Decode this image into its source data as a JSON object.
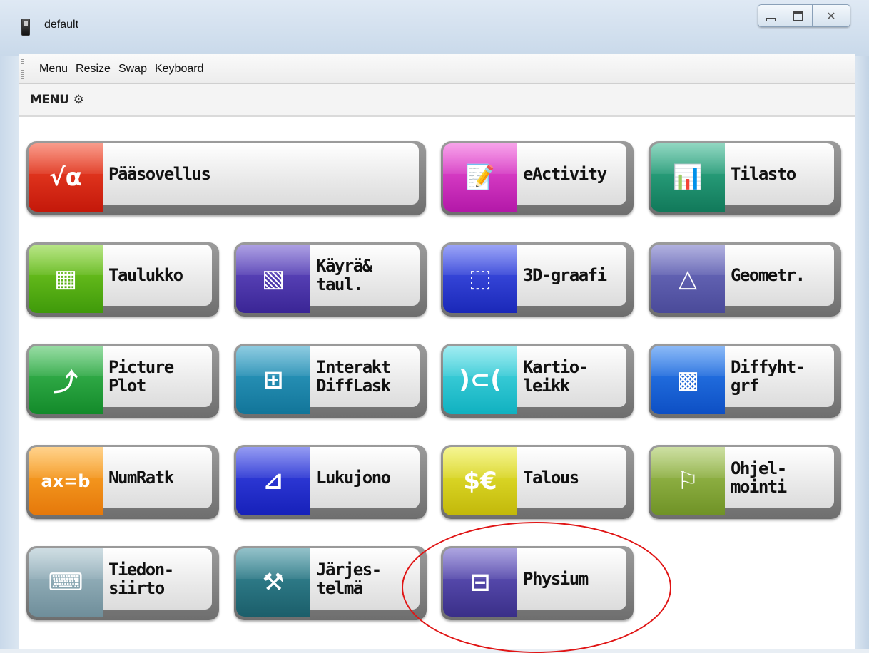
{
  "window": {
    "title": "default",
    "controls": {
      "minimize": "minimize",
      "maximize": "maximize",
      "close": "✕"
    }
  },
  "menubar": {
    "items": [
      "Menu",
      "Resize",
      "Swap",
      "Keyboard"
    ]
  },
  "header": {
    "label": "MENU",
    "gear_icon": "⚙"
  },
  "apps": [
    {
      "label": "Pääsovellus",
      "icon": "√α",
      "color": "red"
    },
    {
      "label": "eActivity",
      "icon": "📝",
      "color": "magenta"
    },
    {
      "label": "Tilasto",
      "icon": "📊",
      "color": "teal"
    },
    {
      "label": "Taulukko",
      "icon": "▦",
      "color": "green"
    },
    {
      "label": "Käyrä&\ntaul.",
      "icon": "▧",
      "color": "purple"
    },
    {
      "label": "3D-graafi",
      "icon": "⬚",
      "color": "blue"
    },
    {
      "label": "Geometr.",
      "icon": "△",
      "color": "slate"
    },
    {
      "label": "Picture\nPlot",
      "icon": "⤴",
      "color": "green2"
    },
    {
      "label": "Interakt\nDiffLask",
      "icon": "⊞",
      "color": "seablue"
    },
    {
      "label": "Kartio-\nleikk",
      "icon": ")⊂(",
      "color": "cyan"
    },
    {
      "label": "Diffyht-\ngrf",
      "icon": "▩",
      "color": "azure"
    },
    {
      "label": "NumRatk",
      "icon": "ax=b",
      "color": "orange"
    },
    {
      "label": "Lukujono",
      "icon": "⊿",
      "color": "royal"
    },
    {
      "label": "Talous",
      "icon": "$€",
      "color": "yellow"
    },
    {
      "label": "Ohjel-\nmointi",
      "icon": "⚐",
      "color": "olive"
    },
    {
      "label": "Tiedon-\nsiirto",
      "icon": "⌨",
      "color": "greyb"
    },
    {
      "label": "Järjes-\ntelmä",
      "icon": "⚒",
      "color": "petrol"
    },
    {
      "label": "Physium",
      "icon": "⊟",
      "color": "indigo"
    }
  ]
}
